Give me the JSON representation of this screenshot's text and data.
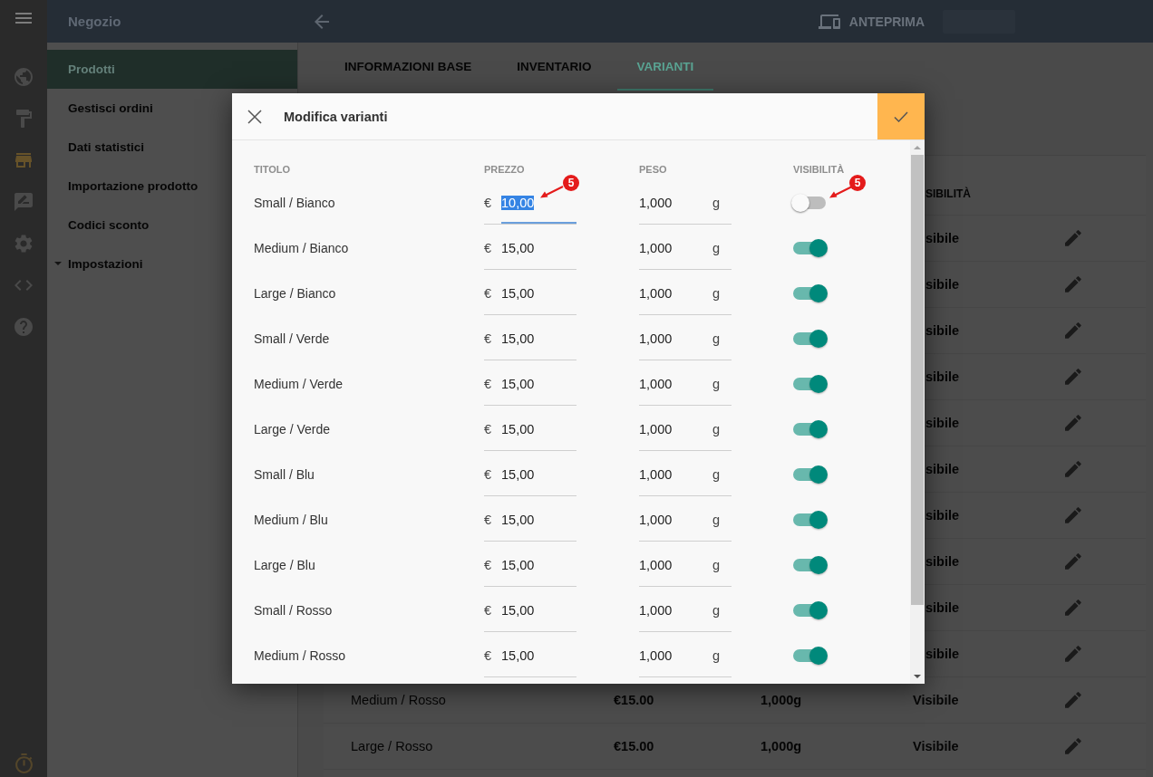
{
  "app_bar": {
    "title": "Negozio",
    "preview_label": "ANTEPRIMA"
  },
  "rail": {
    "items": [
      {
        "selected": false
      },
      {
        "selected": false
      },
      {
        "selected": true
      },
      {
        "selected": false
      },
      {
        "selected": false
      },
      {
        "selected": false
      },
      {
        "selected": false
      }
    ]
  },
  "nav": {
    "items": [
      {
        "label": "Prodotti",
        "kind": "link",
        "selected": true
      },
      {
        "label": "Gestisci ordini",
        "kind": "link",
        "selected": false
      },
      {
        "label": "Dati statistici",
        "kind": "link",
        "selected": false
      },
      {
        "label": "Importazione prodotto",
        "kind": "link",
        "selected": false
      },
      {
        "label": "Codici sconto",
        "kind": "link",
        "selected": false
      },
      {
        "label": "Impostazioni",
        "kind": "group",
        "selected": false
      }
    ]
  },
  "tabs": [
    {
      "label": "INFORMAZIONI BASE",
      "selected": false
    },
    {
      "label": "INVENTARIO",
      "selected": false
    },
    {
      "label": "VARIANTI",
      "selected": true
    }
  ],
  "variant_list": {
    "visibility_header": "SIBILITÀ",
    "rows": [
      {
        "kind": "covered",
        "visibility": "sibile"
      },
      {
        "kind": "covered",
        "visibility": "sibile"
      },
      {
        "kind": "covered",
        "visibility": "sibile"
      },
      {
        "kind": "covered",
        "visibility": "sibile"
      },
      {
        "kind": "covered",
        "visibility": "sibile"
      },
      {
        "kind": "covered",
        "visibility": "sibile"
      },
      {
        "kind": "covered",
        "visibility": "sibile"
      },
      {
        "kind": "covered",
        "visibility": "sibile"
      },
      {
        "kind": "covered",
        "visibility": "sibile"
      },
      {
        "kind": "covered",
        "visibility": "sibile"
      },
      {
        "kind": "full",
        "title": "Medium / Rosso",
        "price": "€15.00",
        "weight": "1,000g",
        "visibility": "Visibile"
      },
      {
        "kind": "full",
        "title": "Large / Rosso",
        "price": "€15.00",
        "weight": "1,000g",
        "visibility": "Visibile"
      }
    ]
  },
  "dialog": {
    "title": "Modifica varianti",
    "columns": [
      "TITOLO",
      "PREZZO",
      "PESO",
      "VISIBILITÀ"
    ],
    "rows": [
      {
        "title": "Small / Bianco",
        "currency": "€",
        "price": "10,00",
        "weight": "1,000",
        "unit": "g",
        "focused": true,
        "visible": false,
        "callouts": {
          "price": "5",
          "visibility": "5"
        }
      },
      {
        "title": "Medium / Bianco",
        "currency": "€",
        "price": "15,00",
        "weight": "1,000",
        "unit": "g",
        "focused": false,
        "visible": true
      },
      {
        "title": "Large / Bianco",
        "currency": "€",
        "price": "15,00",
        "weight": "1,000",
        "unit": "g",
        "focused": false,
        "visible": true
      },
      {
        "title": "Small / Verde",
        "currency": "€",
        "price": "15,00",
        "weight": "1,000",
        "unit": "g",
        "focused": false,
        "visible": true
      },
      {
        "title": "Medium / Verde",
        "currency": "€",
        "price": "15,00",
        "weight": "1,000",
        "unit": "g",
        "focused": false,
        "visible": true
      },
      {
        "title": "Large / Verde",
        "currency": "€",
        "price": "15,00",
        "weight": "1,000",
        "unit": "g",
        "focused": false,
        "visible": true
      },
      {
        "title": "Small / Blu",
        "currency": "€",
        "price": "15,00",
        "weight": "1,000",
        "unit": "g",
        "focused": false,
        "visible": true
      },
      {
        "title": "Medium / Blu",
        "currency": "€",
        "price": "15,00",
        "weight": "1,000",
        "unit": "g",
        "focused": false,
        "visible": true
      },
      {
        "title": "Large / Blu",
        "currency": "€",
        "price": "15,00",
        "weight": "1,000",
        "unit": "g",
        "focused": false,
        "visible": true
      },
      {
        "title": "Small / Rosso",
        "currency": "€",
        "price": "15,00",
        "weight": "1,000",
        "unit": "g",
        "focused": false,
        "visible": true
      },
      {
        "title": "Medium / Rosso",
        "currency": "€",
        "price": "15,00",
        "weight": "1,000",
        "unit": "g",
        "focused": false,
        "visible": true
      }
    ]
  }
}
